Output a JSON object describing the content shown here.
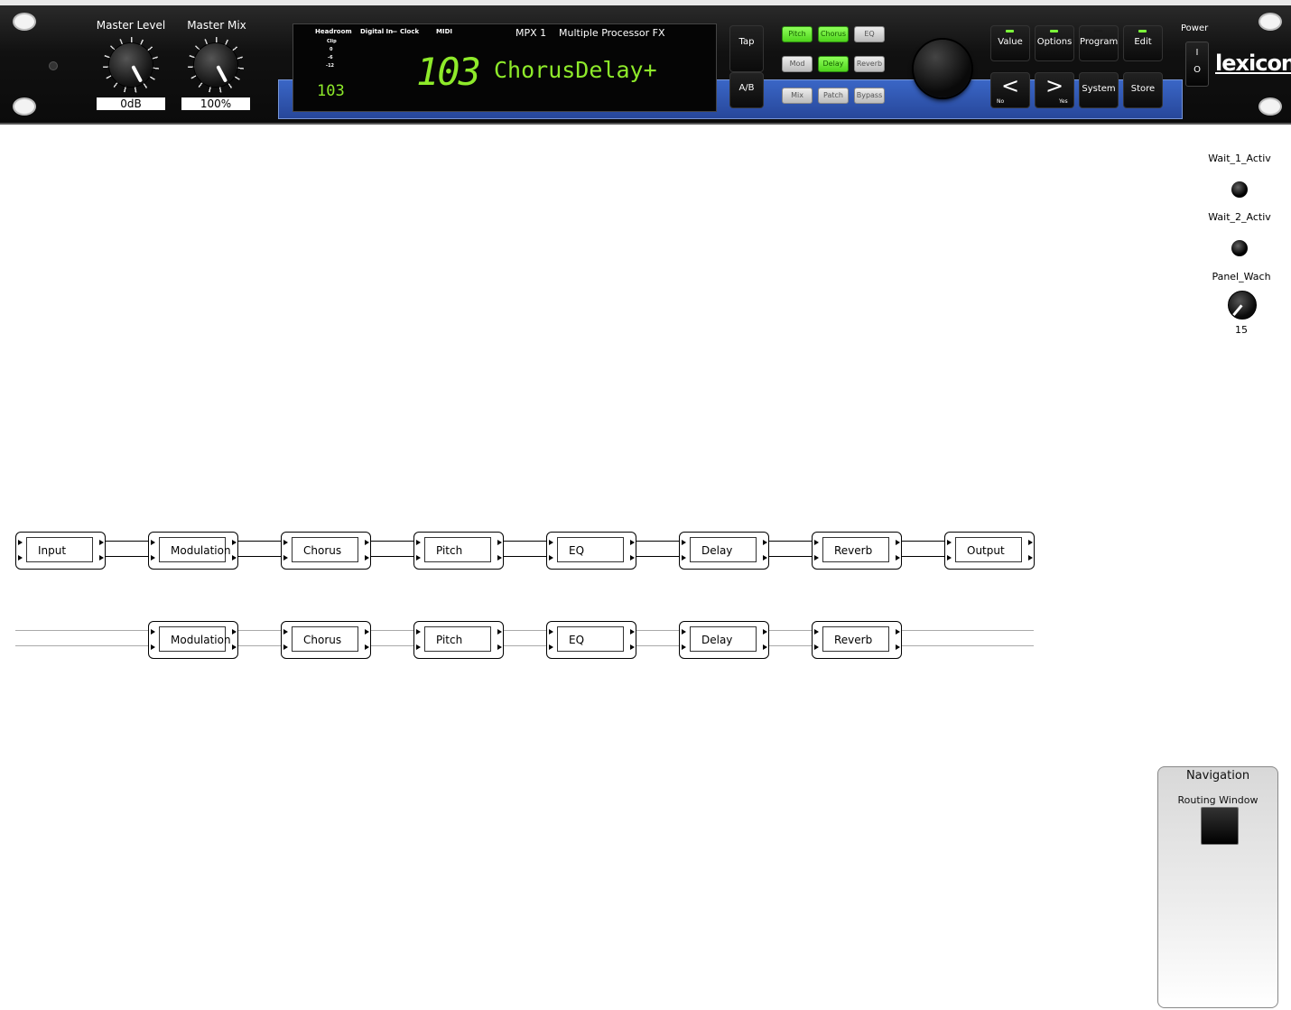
{
  "device": {
    "master_level": {
      "label": "Master Level",
      "value": "0dB"
    },
    "master_mix": {
      "label": "Master Mix",
      "value": "100%"
    },
    "lcd": {
      "headroom": "Headroom",
      "clip": "Clip",
      "h0": "0",
      "h6": "-6",
      "h12": "-12",
      "digital_in": "Digital In",
      "dash": "—",
      "clock": "Clock",
      "midi": "MIDI",
      "model": "MPX 1",
      "subtitle": "Multiple Processor FX",
      "program_small": "103",
      "program_big": "103",
      "program_name": "ChorusDelay+"
    },
    "tap": "Tap",
    "ab": "A/B",
    "fx_buttons": [
      {
        "label": "Pitch",
        "on": true
      },
      {
        "label": "Chorus",
        "on": true
      },
      {
        "label": "EQ",
        "on": false
      },
      {
        "label": "Mod",
        "on": false
      },
      {
        "label": "Delay",
        "on": true
      },
      {
        "label": "Reverb",
        "on": false
      },
      {
        "label": "Mix",
        "on": false
      },
      {
        "label": "Patch",
        "on": false
      },
      {
        "label": "Bypass",
        "on": false
      }
    ],
    "mode_buttons": [
      {
        "label": "Value",
        "led": true
      },
      {
        "label": "Options",
        "led": true
      },
      {
        "label": "Program",
        "led": false
      },
      {
        "label": "Edit",
        "led": true
      }
    ],
    "nav_buttons": [
      {
        "label": "<",
        "sub": "No"
      },
      {
        "label": ">",
        "sub": "Yes"
      },
      {
        "label": "System",
        "sub": ""
      },
      {
        "label": "Store",
        "sub": ""
      }
    ],
    "power": "Power",
    "power_on": "I",
    "power_off": "O",
    "logo": "lexicon"
  },
  "side": {
    "wait1": "Wait_1_Activ",
    "wait2": "Wait_2_Activ",
    "panel_wach": "Panel_Wach",
    "panel_wach_value": "15"
  },
  "chain_row1": [
    "Input",
    "Modulation",
    "Chorus",
    "Pitch",
    "EQ",
    "Delay",
    "Reverb",
    "Output"
  ],
  "chain_row2": [
    "",
    "Modulation",
    "Chorus",
    "Pitch",
    "EQ",
    "Delay",
    "Reverb",
    ""
  ],
  "navigation": {
    "title": "Navigation",
    "routing": "Routing Window"
  }
}
